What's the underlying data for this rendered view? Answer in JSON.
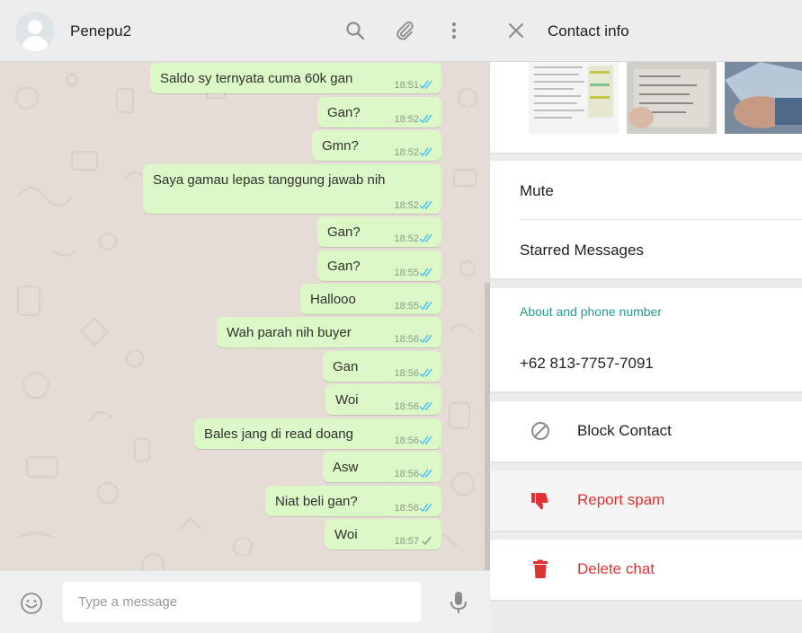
{
  "chat": {
    "contact_name": "Penepu2",
    "colors": {
      "bubble_out": "#dcf8c6",
      "wallpaper": "#e5ddd5",
      "tick_read": "#4fc3f7",
      "tick_sent": "#8a9a8a"
    },
    "messages": [
      {
        "text": "Saldo sy ternyata cuma 60k gan",
        "time": "18:51",
        "status": "read"
      },
      {
        "text": "Gan?",
        "time": "18:52",
        "status": "read"
      },
      {
        "text": "Gmn?",
        "time": "18:52",
        "status": "read"
      },
      {
        "text": "Saya gamau lepas tanggung jawab nih",
        "time": "18:52",
        "status": "read"
      },
      {
        "text": "Gan?",
        "time": "18:52",
        "status": "read"
      },
      {
        "text": "Gan?",
        "time": "18:55",
        "status": "read"
      },
      {
        "text": "Hallooo",
        "time": "18:55",
        "status": "read"
      },
      {
        "text": "Wah parah nih buyer",
        "time": "18:56",
        "status": "read"
      },
      {
        "text": "Gan",
        "time": "18:56",
        "status": "read"
      },
      {
        "text": "Woi",
        "time": "18:56",
        "status": "read"
      },
      {
        "text": "Bales jang di read doang",
        "time": "18:56",
        "status": "read"
      },
      {
        "text": "Asw",
        "time": "18:56",
        "status": "read"
      },
      {
        "text": "Niat beli gan?",
        "time": "18:56",
        "status": "read"
      },
      {
        "text": "Woi",
        "time": "18:57",
        "status": "sent"
      }
    ],
    "composer": {
      "placeholder": "Type a message",
      "value": ""
    },
    "icons": {
      "search": "search-icon",
      "attach": "paperclip-icon",
      "menu": "more-vertical-icon",
      "emoji": "emoji-icon",
      "mic": "microphone-icon"
    }
  },
  "contact_info": {
    "title": "Contact info",
    "close_icon": "close-icon",
    "settings": {
      "mute_label": "Mute",
      "starred_label": "Starred Messages"
    },
    "about": {
      "section_label": "About and phone number",
      "phone": "+62 813-7757-7091"
    },
    "actions": {
      "block": {
        "label": "Block Contact",
        "icon": "block-icon",
        "color": "#202020"
      },
      "report": {
        "label": "Report spam",
        "icon": "thumbs-down-icon",
        "color": "#df3333"
      },
      "delete": {
        "label": "Delete chat",
        "icon": "trash-icon",
        "color": "#df3333"
      }
    }
  }
}
